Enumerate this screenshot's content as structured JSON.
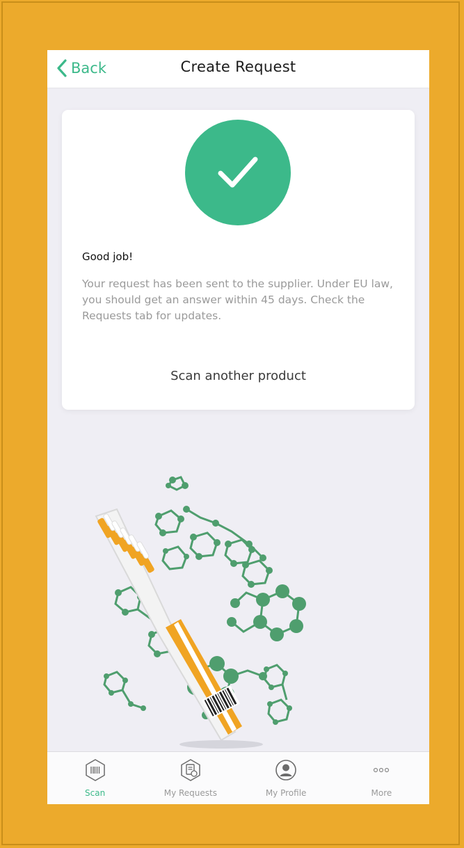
{
  "navbar": {
    "back_label": "Back",
    "title": "Create Request"
  },
  "card": {
    "icon": "checkmark-icon",
    "title": "Good job!",
    "body": "Your request has been sent to the supplier. Under EU law, you should get an answer within 45 days. Check the Requests tab for updates.",
    "action_label": "Scan another product"
  },
  "illustration": {
    "icon": "toothbrush-molecules-illustration"
  },
  "tabbar": {
    "tabs": [
      {
        "label": "Scan",
        "icon": "barcode-scan-icon",
        "active": true
      },
      {
        "label": "My Requests",
        "icon": "document-requests-icon",
        "active": false
      },
      {
        "label": "My Profile",
        "icon": "user-profile-icon",
        "active": false
      },
      {
        "label": "More",
        "icon": "more-dots-icon",
        "active": false
      }
    ]
  },
  "colors": {
    "accent": "#3cb98a",
    "page_background": "#ecaa2c",
    "screen_background": "#efeef4",
    "inactive_tab": "#9a9a9a",
    "molecule_green": "#4f9e6e",
    "toothbrush_orange": "#f0a423"
  }
}
